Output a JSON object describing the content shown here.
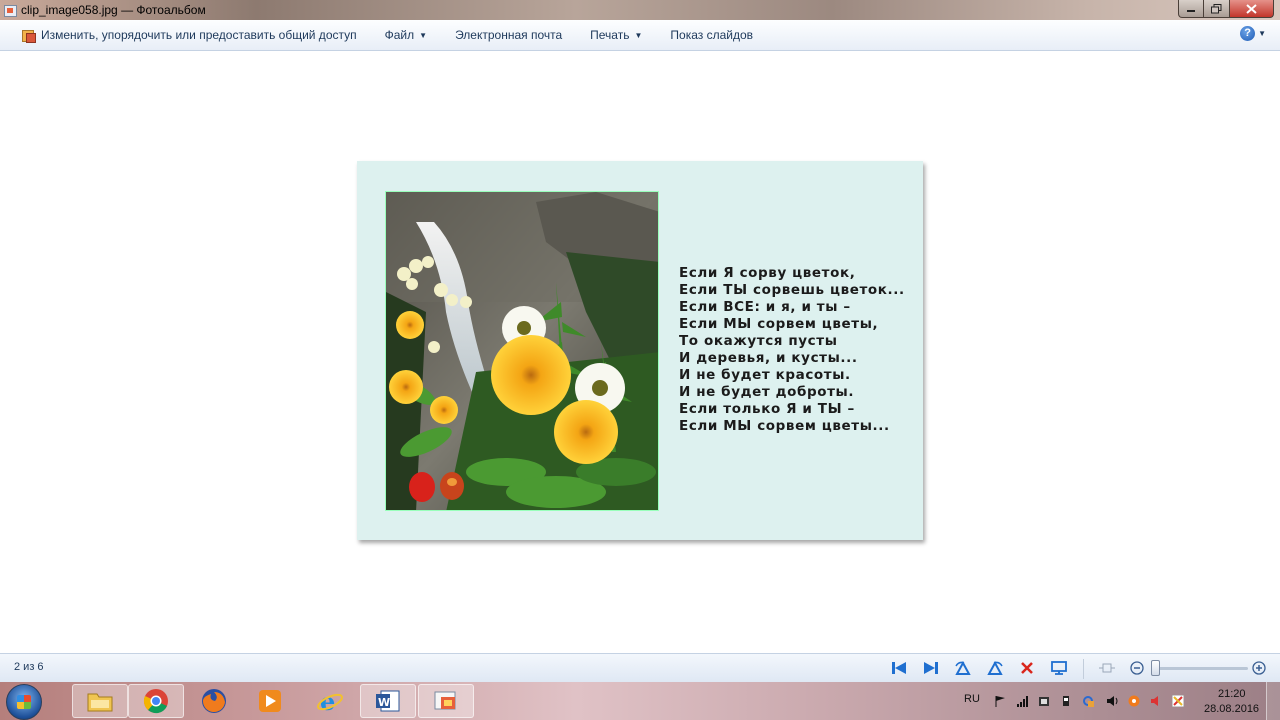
{
  "window": {
    "title": "clip_image058.jpg — Фотоальбом",
    "app_icon": "photo-gallery-icon"
  },
  "commandbar": {
    "edit_share": "Изменить, упорядочить или предоставить общий доступ",
    "file": "Файл",
    "email": "Электронная почта",
    "print": "Печать",
    "slideshow": "Показ слайдов"
  },
  "poem": {
    "lines": [
      "Если Я сорву цветок,",
      "Если ТЫ сорвешь цветок...",
      "Если ВСЕ: и я, и ты –",
      "Если МЫ сорвем цветы,",
      "То окажутся пусты",
      "И деревья, и кусты...",
      "И не будет красоты.",
      "И не будет доброты.",
      "Если только Я и ТЫ –",
      "Если МЫ сорвем цветы..."
    ]
  },
  "navbar": {
    "counter": "2 из 6",
    "zoom_level": 0.03
  },
  "taskbar": {
    "language": "RU",
    "time": "21:20",
    "date": "28.08.2016",
    "apps": [
      "file-explorer",
      "chrome",
      "firefox",
      "media-player",
      "internet-explorer",
      "word",
      "photo-gallery"
    ]
  },
  "colors": {
    "photo_background": "#ddf1ef",
    "commandbar_text": "#1e395b",
    "nav_icon_blue": "#1f6fd0",
    "delete_red": "#d9261c"
  }
}
